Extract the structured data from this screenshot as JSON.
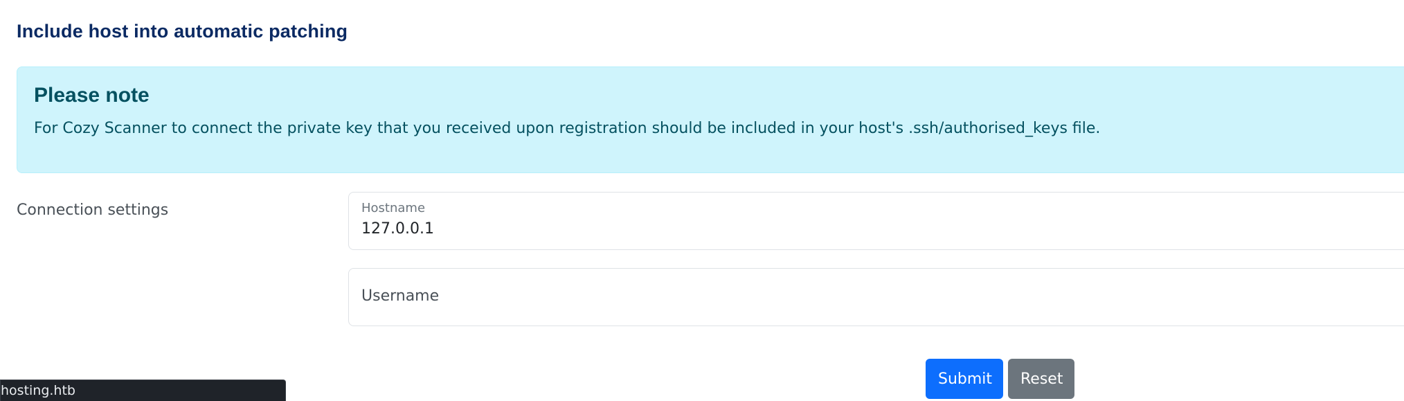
{
  "section": {
    "title": "Include host into automatic patching"
  },
  "alert": {
    "heading": "Please note",
    "text": "For Cozy Scanner to connect the private key that you received upon registration should be included in your host's .ssh/authorised_keys file."
  },
  "form": {
    "row_label": "Connection settings",
    "hostname": {
      "label": "Hostname",
      "value": "127.0.0.1"
    },
    "username": {
      "placeholder": "Username",
      "value": ""
    },
    "submit_label": "Submit",
    "reset_label": "Reset"
  },
  "status_bar": {
    "text": "hosting.htb"
  },
  "colors": {
    "title": "#0b2a63",
    "alert_bg": "#cff4fc",
    "alert_text": "#055160",
    "primary": "#0d6efd",
    "secondary": "#6c757d"
  }
}
